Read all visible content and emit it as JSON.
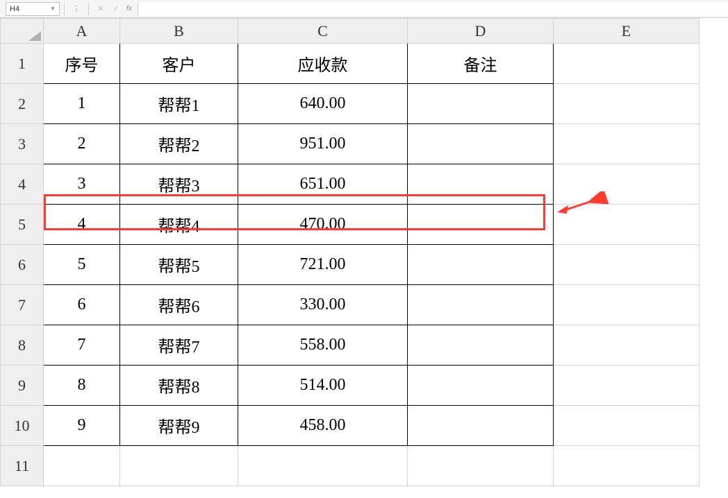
{
  "formula_bar": {
    "name_box_value": "H4",
    "fx_label": "fx"
  },
  "column_headers": [
    "A",
    "B",
    "C",
    "D",
    "E"
  ],
  "row_headers": [
    "1",
    "2",
    "3",
    "4",
    "5",
    "6",
    "7",
    "8",
    "9",
    "10",
    "11"
  ],
  "table": {
    "headers": {
      "col_a": "序号",
      "col_b": "客户",
      "col_c": "应收款",
      "col_d": "备注"
    },
    "rows": [
      {
        "seq": "1",
        "customer": "帮帮1",
        "amount": "640.00",
        "note": ""
      },
      {
        "seq": "2",
        "customer": "帮帮2",
        "amount": "951.00",
        "note": ""
      },
      {
        "seq": "3",
        "customer": "帮帮3",
        "amount": "651.00",
        "note": ""
      },
      {
        "seq": "4",
        "customer": "帮帮4",
        "amount": "470.00",
        "note": ""
      },
      {
        "seq": "5",
        "customer": "帮帮5",
        "amount": "721.00",
        "note": ""
      },
      {
        "seq": "6",
        "customer": "帮帮6",
        "amount": "330.00",
        "note": ""
      },
      {
        "seq": "7",
        "customer": "帮帮7",
        "amount": "558.00",
        "note": ""
      },
      {
        "seq": "8",
        "customer": "帮帮8",
        "amount": "514.00",
        "note": ""
      },
      {
        "seq": "9",
        "customer": "帮帮9",
        "amount": "458.00",
        "note": ""
      }
    ]
  },
  "highlight": {
    "row_index": 3,
    "color": "#ff3b30"
  }
}
